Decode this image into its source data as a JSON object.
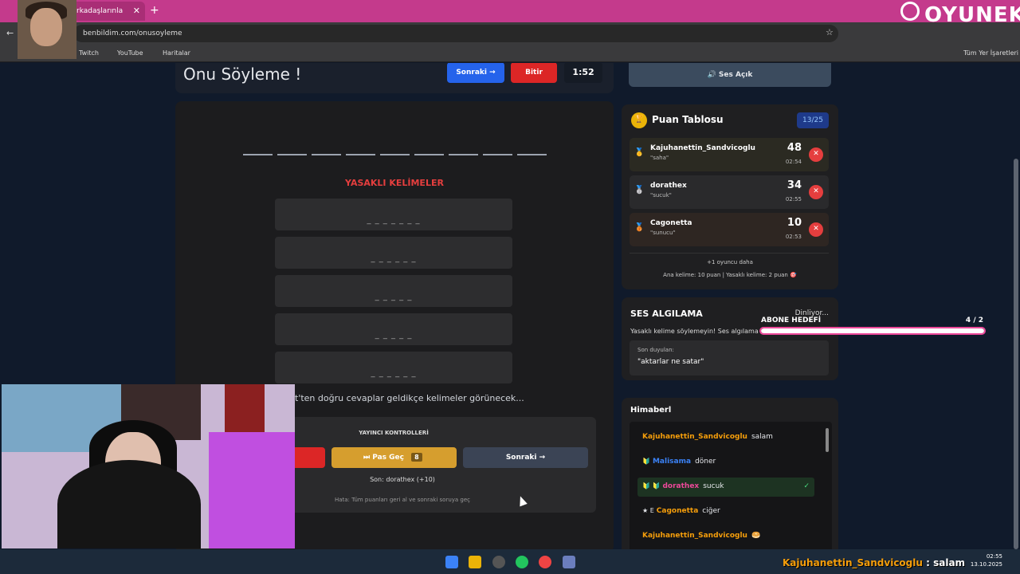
{
  "browser": {
    "tab_title": "rkadaşlarınla",
    "url": "benbildim.com/onusoyleme",
    "bookmarks": [
      "Twitch",
      "YouTube",
      "Haritalar"
    ],
    "bookmarks_right": "Tüm Yer İşaretleri"
  },
  "header": {
    "title": "Onu Söyleme !",
    "next_label": "Sonraki →",
    "finish_label": "Bitir",
    "timer": "1:52"
  },
  "game": {
    "blank_count": 9,
    "forbidden_title": "YASAKLI KELİMELER",
    "forbidden_words": [
      "_ _ _ _ _ _ _",
      "_ _ _ _ _ _",
      "_ _ _ _ _",
      "_ _ _ _ _",
      "_ _ _ _ _ _"
    ],
    "hint": "t'ten doğru cevaplar geldikçe kelimeler görünecek..."
  },
  "controls": {
    "title": "YAYINCI KONTROLLERİ",
    "pass_label": "⏭ Pas Geç",
    "pass_count": "8",
    "next_label": "Sonraki →",
    "last": "Son: dorathex (+10)",
    "note": "Hata: Tüm puanları geri al ve sonraki soruya geç"
  },
  "sound": {
    "label": "🔊 Ses Açık"
  },
  "scoreboard": {
    "title": "Puan Tablosu",
    "badge": "13/25",
    "players": [
      {
        "medal": "🥇",
        "name": "Kajuhanettin_Sandvicoglu",
        "word": "\"saha\"",
        "score": "48",
        "time": "02:54",
        "bg": "#2b2a22"
      },
      {
        "medal": "🥈",
        "name": "dorathex",
        "word": "\"sucuk\"",
        "score": "34",
        "time": "02:55",
        "bg": "#2a2a2c"
      },
      {
        "medal": "🥉",
        "name": "Cagonetta",
        "word": "\"sunucu\"",
        "score": "10",
        "time": "02:53",
        "bg": "#2e2622"
      }
    ],
    "more": "+1 oyuncu daha",
    "rules": "Ana kelime: 10 puan | Yasaklı kelime: 2 puan 🎯"
  },
  "voice": {
    "title": "SES ALGILAMA",
    "status": "Dinliyor...",
    "warning": "Yasaklı kelime söylemeyin! Ses algılama sistemi aktif.",
    "heard_label": "Son duyulan:",
    "heard_text": "\"aktarlar ne satar\""
  },
  "sub_goal": {
    "label": "ABONE HEDEFİ",
    "count": "4  / 2",
    "progress": 1.0,
    "colors": {
      "border": "#ec4899",
      "fill": "#ffffff"
    }
  },
  "chat": {
    "title": "Himaberl",
    "messages": [
      {
        "badge": "",
        "user": "Kajuhanettin_Sandvicoglu",
        "color": "#f59e0b",
        "text": "salam",
        "bg": "transparent",
        "check": ""
      },
      {
        "badge": "🔰",
        "user": "Malisama",
        "color": "#3b82f6",
        "text": "döner",
        "bg": "transparent",
        "check": ""
      },
      {
        "badge": "🔰 🔰",
        "user": "dorathex",
        "color": "#ec4899",
        "text": "sucuk",
        "bg": "#1d3322",
        "check": "✓"
      },
      {
        "badge": "★ E",
        "user": "Cagonetta",
        "color": "#f59e0b",
        "text": "ciğer",
        "bg": "transparent",
        "check": ""
      },
      {
        "badge": "",
        "user": "Kajuhanettin_Sandvicoglu",
        "color": "#f59e0b",
        "text": "🥯",
        "bg": "transparent",
        "check": ""
      }
    ]
  },
  "overlay": {
    "brand": "OYUNEKS",
    "stream_chat_user": "Kajuhanettin_Sandvicoglu",
    "stream_chat_msg": ": salam",
    "date": "13.10.2025",
    "time": "02:55"
  }
}
